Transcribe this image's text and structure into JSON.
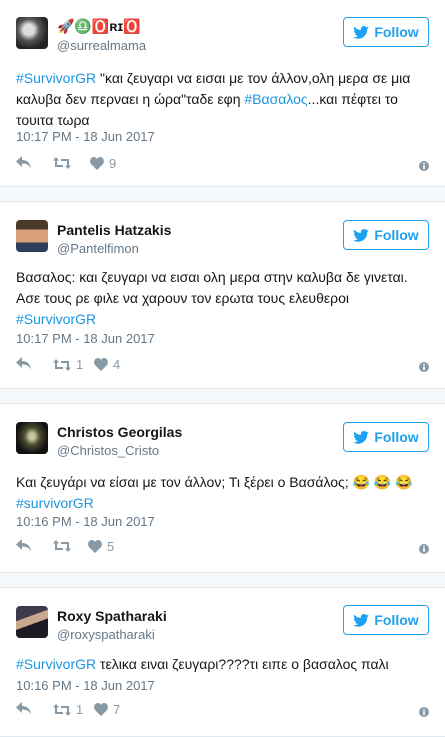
{
  "follow_label": "Follow",
  "tweets": [
    {
      "name": "🚀♎️🅾️ʀɪ🅾️",
      "handle": "@surrealmama",
      "text_parts": [
        "#SurvivorGR",
        " \"και ζευγαρι να εισαι με τον άλλον,ολη μερα σε μια καλυβα δεν περναει η ώρα\"ταδε εφη ",
        "#Βασαλος",
        "...και πέφτει το τουιτα τωρα"
      ],
      "time": "10:17 PM - 18 Jun 2017",
      "retweets": "",
      "likes": "9"
    },
    {
      "name": "Pantelis Hatzakis",
      "handle": "@Pantelfimon",
      "text_parts": [
        "Βασαλος: και ζευγαρι να εισαι ολη μερα στην καλυβα δε γινεται. Ασε τους ρε φιλε να χαρουν τον ερωτα τους ελευθεροι",
        "#SurvivorGR"
      ],
      "time": "10:17 PM - 18 Jun 2017",
      "retweets": "1",
      "likes": "4"
    },
    {
      "name": "Christos Georgilas",
      "handle": "@Christos_Cristo",
      "text_parts": [
        "Και ζευγάρι να είσαι με τον άλλον; Τι ξέρει ο Βασάλος; 😂 😂 😂",
        "#survivorGR"
      ],
      "time": "10:16 PM - 18 Jun 2017",
      "retweets": "",
      "likes": "5"
    },
    {
      "name": "Roxy Spatharaki",
      "handle": "@roxyspatharaki",
      "text_parts": [
        "#SurvivorGR",
        " τελικα ειναι ζευγαρι????τι ειπε ο βασαλος παλι"
      ],
      "time": "10:16 PM - 18 Jun 2017",
      "retweets": "1",
      "likes": "7"
    }
  ],
  "colors": {
    "accent": "#1da1f2",
    "link": "#1b95e0",
    "muted": "#657786",
    "icon": "#8899a6"
  }
}
